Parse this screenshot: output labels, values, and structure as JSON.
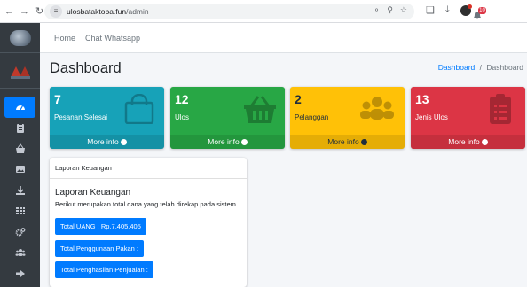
{
  "browser": {
    "url_host": "ulosbataktoba.fun",
    "url_path": "/admin"
  },
  "navbar": {
    "home_label": "Home",
    "chat_label": "Chat Whatsapp",
    "notification_count": "10"
  },
  "content_header": {
    "title": "Dashboard",
    "breadcrumb_link": "Dashboard",
    "breadcrumb_sep": "/",
    "breadcrumb_current": "Dashboard"
  },
  "boxes": [
    {
      "count": "7",
      "label": "Pesanan Selesai",
      "footer": "More info",
      "color": "#17a2b8",
      "icon": "shopping-bag-icon"
    },
    {
      "count": "12",
      "label": "Ulos",
      "footer": "More info",
      "color": "#28a745",
      "icon": "shopping-basket-icon"
    },
    {
      "count": "2",
      "label": "Pelanggan",
      "footer": "More info",
      "color": "#ffc107",
      "icon": "users-icon"
    },
    {
      "count": "13",
      "label": "Jenis Ulos",
      "footer": "More info",
      "color": "#dc3545",
      "icon": "clipboard-list-icon"
    }
  ],
  "finance_card": {
    "header": "Laporan Keuangan",
    "title": "Laporan Keuangan",
    "description": "Berikut merupakan total dana yang telah direkap pada sistem.",
    "buttons": [
      {
        "label": "Total UANG : Rp.7,405,405"
      },
      {
        "label": "Total Penggunaan Pakan :"
      },
      {
        "label": "Total Penghasilan Penjualan :"
      }
    ]
  },
  "sidebar": {
    "items": [
      {
        "icon": "dashboard-gauge-icon",
        "active": true
      },
      {
        "icon": "clipboard-icon",
        "active": false
      },
      {
        "icon": "shopping-basket-icon",
        "active": false
      },
      {
        "icon": "image-icon",
        "active": false
      },
      {
        "icon": "download-icon",
        "active": false
      },
      {
        "icon": "table-grid-icon",
        "active": false
      },
      {
        "icon": "cogs-icon",
        "active": false
      },
      {
        "icon": "users-icon",
        "active": false
      },
      {
        "icon": "sign-out-icon",
        "active": false
      }
    ]
  },
  "colors": {
    "sidebar_bg": "#343a40",
    "primary": "#007bff",
    "page_bg": "#f4f6f9"
  }
}
